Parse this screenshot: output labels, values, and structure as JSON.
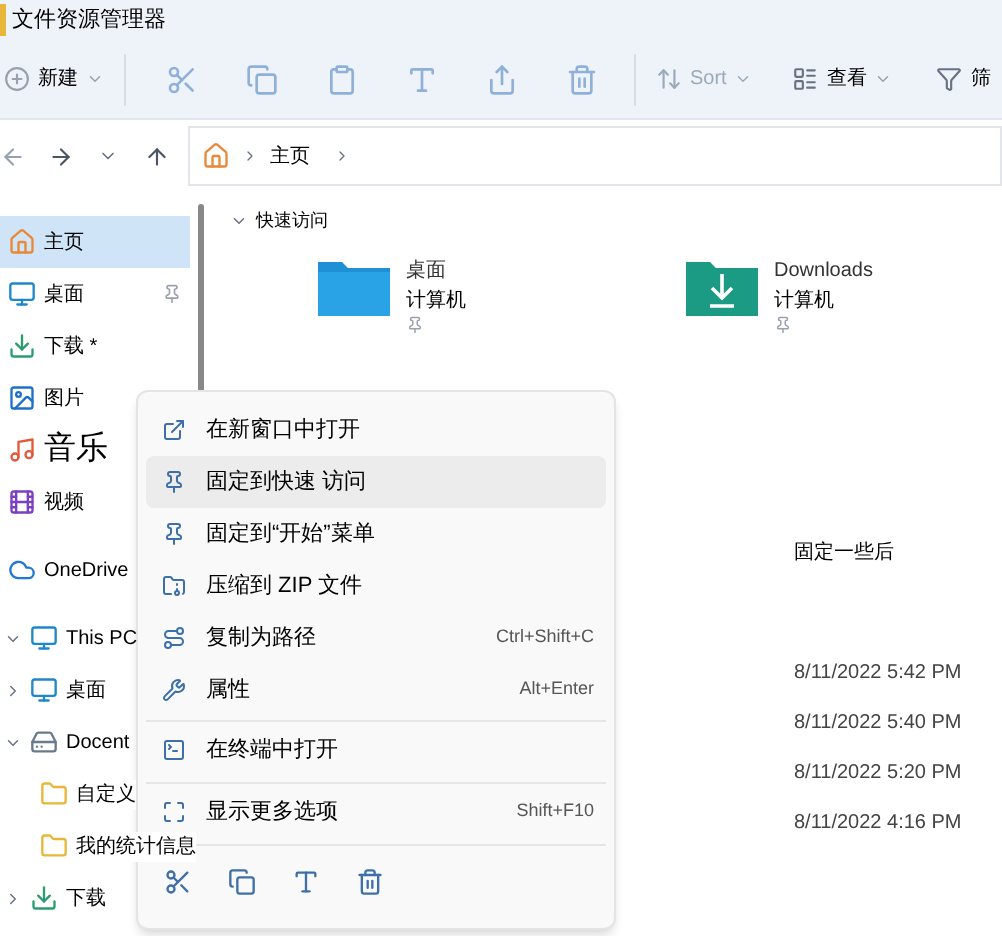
{
  "window": {
    "title": "文件资源管理器"
  },
  "toolbar": {
    "new_label": "新建",
    "sort_label": "Sort",
    "view_label": "查看",
    "filter_label": "筛"
  },
  "address": {
    "crumbs": [
      "主页"
    ]
  },
  "sidebar": {
    "items": [
      {
        "label": "主页",
        "kind": "home",
        "selected": true,
        "pinned": false
      },
      {
        "label": "桌面",
        "kind": "desktop",
        "selected": false,
        "pinned": true
      },
      {
        "label": "下载 *",
        "kind": "download",
        "selected": false,
        "pinned": false
      },
      {
        "label": "图片",
        "kind": "pictures",
        "selected": false,
        "pinned": false
      },
      {
        "label": "音乐",
        "kind": "music",
        "selected": false,
        "pinned": false,
        "large": true
      },
      {
        "label": "视频",
        "kind": "videos",
        "selected": false
      },
      {
        "label": "OneDrive",
        "kind": "cloud",
        "selected": false
      },
      {
        "label": "This PC",
        "kind": "pc",
        "selected": false,
        "expanded": true,
        "children": [
          {
            "label": "桌面",
            "kind": "desktop",
            "selected": false,
            "expanded": false
          },
          {
            "label": "Docent",
            "kind": "drive",
            "selected": false,
            "expanded": true,
            "children": [
              {
                "label": "自定义",
                "kind": "folder",
                "selected": false
              },
              {
                "label": "我的统计信息",
                "kind": "folder",
                "selected": false
              }
            ]
          },
          {
            "label": "下载",
            "kind": "download",
            "selected": false,
            "expanded": false
          }
        ]
      }
    ]
  },
  "quick_access": {
    "heading": "快速访问",
    "expanded": true,
    "items": [
      {
        "name": "桌面",
        "location": "计算机",
        "kind": "desktop",
        "pinned": true
      },
      {
        "name": "Downloads",
        "location": "计算机",
        "kind": "download",
        "pinned": true
      }
    ]
  },
  "recent": {
    "heading": "固定一些后",
    "dates": [
      "8/11/2022 5:42 PM",
      "8/11/2022 5:40 PM",
      "8/11/2022 5:20 PM",
      "8/11/2022 4:16 PM"
    ]
  },
  "context_menu": {
    "sections": [
      [
        {
          "label": "在新窗口中打开",
          "kind": "open-new",
          "selected": false
        },
        {
          "label": "固定到快速 访问",
          "kind": "pin",
          "selected": true
        },
        {
          "label": "固定到“开始”菜单",
          "kind": "pin",
          "selected": false
        },
        {
          "label": "压缩到 ZIP 文件",
          "kind": "zip",
          "selected": false
        },
        {
          "label": "复制为路径",
          "kind": "path",
          "selected": false,
          "shortcut": "Ctrl+Shift+C"
        },
        {
          "label": "属性",
          "kind": "wrench",
          "selected": false,
          "shortcut": "Alt+Enter"
        }
      ],
      [
        {
          "label": "在终端中打开",
          "kind": "terminal",
          "selected": false
        }
      ],
      [
        {
          "label": "显示更多选项",
          "kind": "more",
          "selected": false,
          "shortcut": "Shift+F10"
        }
      ]
    ],
    "bottom_icons": [
      {
        "kind": "cut"
      },
      {
        "kind": "copy"
      },
      {
        "kind": "rename"
      },
      {
        "kind": "delete"
      }
    ]
  }
}
